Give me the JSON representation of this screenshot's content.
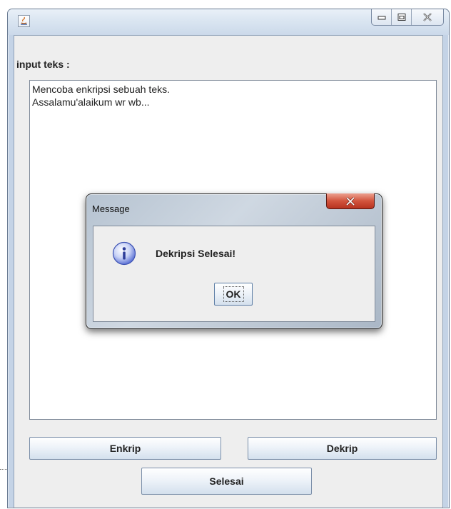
{
  "window": {
    "title": "",
    "controls": [
      "minimize-icon",
      "maximize-icon",
      "close-icon"
    ]
  },
  "main": {
    "input_label": "input teks :",
    "text_lines": [
      "Mencoba enkripsi sebuah teks.",
      "Assalamu'alaikum wr wb..."
    ],
    "buttons": {
      "encrypt": "Enkrip",
      "decrypt": "Dekrip",
      "finish": "Selesai"
    }
  },
  "dialog": {
    "title": "Message",
    "icon": "info-icon",
    "message": "Dekripsi Selesai!",
    "ok_label": "OK"
  },
  "colors": {
    "window_frame": "#c4d3e6",
    "client_bg": "#eeeeee",
    "close_button": "#c8432c",
    "info_icon": "#5f74d6"
  }
}
